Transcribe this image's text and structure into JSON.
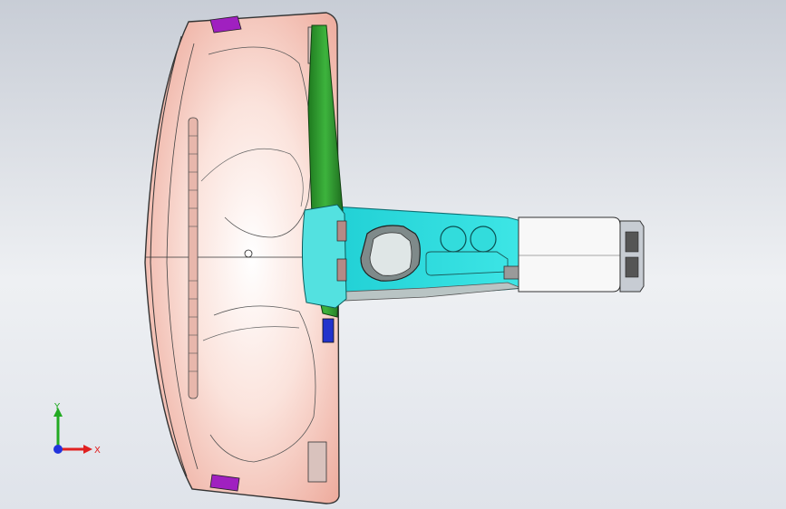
{
  "viewport": {
    "background_top": "#c8cdd6",
    "background_bottom": "#dfe3ea"
  },
  "model": {
    "dashboard_fill": "#f7d4cc",
    "dashboard_shade": "#e9a79a",
    "side_trim_color": "#2e8b2e",
    "console_color": "#23d8d8",
    "armrest_color": "#f7f7f7",
    "vent_accent": "#a020c0",
    "blue_accent": "#2233cc"
  },
  "triad": {
    "x_label": "X",
    "y_label": "Y",
    "x_color": "#e02020",
    "y_color": "#22aa22",
    "z_color": "#2233dd"
  }
}
